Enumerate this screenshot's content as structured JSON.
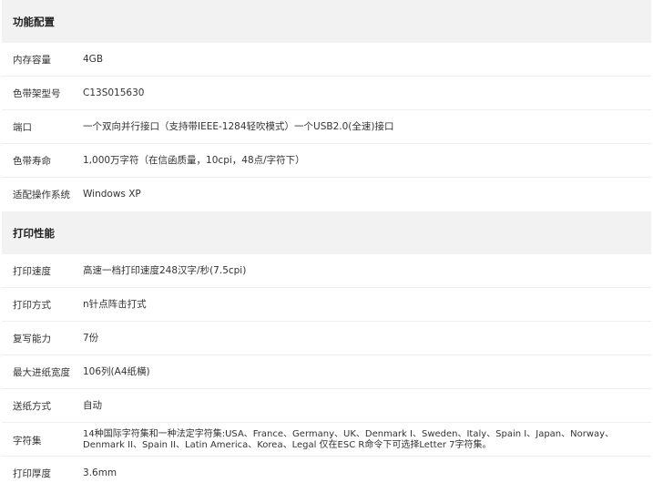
{
  "sections": [
    {
      "title": "功能配置",
      "rows": [
        {
          "label": "内存容量",
          "value": "4GB"
        },
        {
          "label": "色带架型号",
          "value": "C13S015630"
        },
        {
          "label": "端口",
          "value": "一个双向并行接口（支持带IEEE-1284轻吹模式）一个USB2.0(全速)接口"
        },
        {
          "label": "色带寿命",
          "value": "1,000万字符（在信函质量，10cpi，48点/字符下）"
        },
        {
          "label": "适配操作系统",
          "value": "Windows XP"
        }
      ]
    },
    {
      "title": "打印性能",
      "rows": [
        {
          "label": "打印速度",
          "value": "高速一档打印速度248汉字/秒(7.5cpi)"
        },
        {
          "label": "打印方式",
          "value": "n针点阵击打式"
        },
        {
          "label": "复写能力",
          "value": "7份"
        },
        {
          "label": "最大进纸宽度",
          "value": "106列(A4纸横)"
        },
        {
          "label": "送纸方式",
          "value": "自动"
        },
        {
          "label": "字符集",
          "value": "14种国际字符集和一种法定字符集:USA、France、Germany、UK、Denmark I、Sweden、Italy、Spain I、Japan、Norway、Denmark II、Spain II、Latin America、Korea、Legal 仅在ESC R命令下可选择Letter 7字符集。"
        },
        {
          "label": "打印厚度",
          "value": "3.6mm"
        }
      ]
    }
  ]
}
